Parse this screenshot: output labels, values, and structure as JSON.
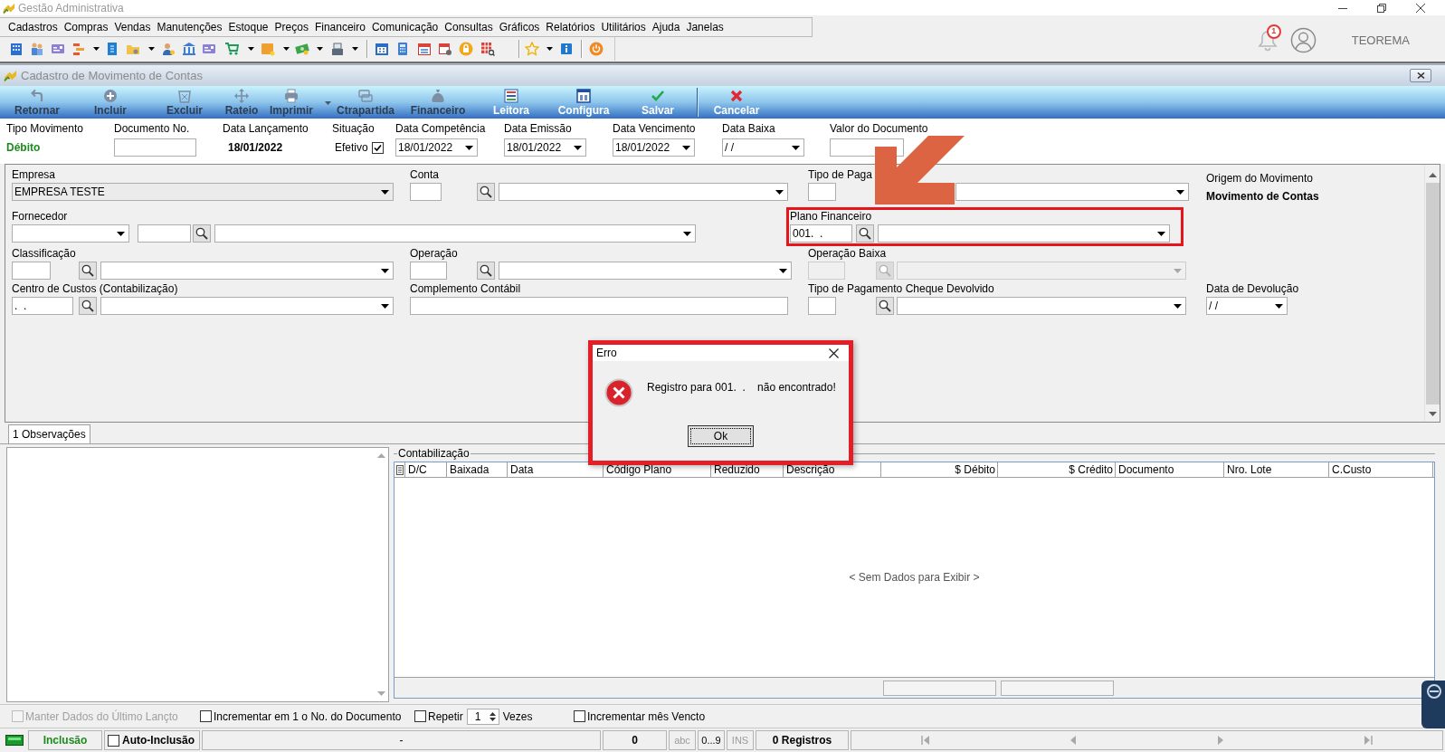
{
  "window": {
    "title": "Gestão Administrativa"
  },
  "menu": [
    "Cadastros",
    "Compras",
    "Vendas",
    "Manutenções",
    "Estoque",
    "Preços",
    "Financeiro",
    "Comunicação",
    "Consultas",
    "Gráficos",
    "Relatórios",
    "Utilitários",
    "Ajuda",
    "Janelas"
  ],
  "notifications": {
    "count": "1"
  },
  "user": {
    "name": "TEOREMA"
  },
  "document_window": {
    "title": "Cadastro de Movimento de Contas"
  },
  "toolbar": {
    "buttons": [
      {
        "label": "Retornar",
        "disabled": true,
        "menu": false
      },
      {
        "label": "Incluir",
        "disabled": true,
        "menu": false
      },
      {
        "label": "Excluir",
        "disabled": true,
        "menu": false
      },
      {
        "label": "Rateio",
        "disabled": true,
        "menu": false
      },
      {
        "label": "Imprimir",
        "disabled": true,
        "menu": true
      },
      {
        "label": "Ctrapartida",
        "disabled": true,
        "menu": false
      },
      {
        "label": "Financeiro",
        "disabled": true,
        "menu": false
      },
      {
        "label": "Leitora",
        "disabled": false,
        "menu": false
      },
      {
        "label": "Configura",
        "disabled": false,
        "menu": false
      },
      {
        "label": "Salvar",
        "disabled": false,
        "menu": false
      }
    ],
    "trailing": [
      {
        "label": "Cancelar",
        "disabled": false,
        "menu": false
      }
    ]
  },
  "header": [
    {
      "kind": "status",
      "label": "Tipo Movimento",
      "value": "Débito"
    },
    {
      "kind": "input",
      "label": "Documento No."
    },
    {
      "kind": "value",
      "label": "Data Lançamento",
      "value": "18/01/2022"
    },
    {
      "kind": "check",
      "label": "Situação",
      "text": "Efetivo",
      "checked": true
    },
    {
      "kind": "date",
      "label": "Data Competência",
      "value": "18/01/2022"
    },
    {
      "kind": "date",
      "label": "Data Emissão",
      "value": "18/01/2022"
    },
    {
      "kind": "date",
      "label": "Data Vencimento",
      "value": "18/01/2022"
    },
    {
      "kind": "date",
      "label": "Data Baixa",
      "value": "/ /"
    },
    {
      "kind": "input",
      "label": "Valor do Documento"
    }
  ],
  "form": {
    "fields": [
      {
        "kind": "combo",
        "label": "Empresa",
        "value": "EMPRESA TESTE",
        "disabled": false,
        "highlighted": false
      },
      {
        "kind": "lookup",
        "label": "Conta",
        "disabled": false,
        "highlighted": false
      },
      {
        "kind": "code_combo",
        "label": "Tipo de Paga",
        "disabled": false,
        "highlighted": false
      },
      {
        "kind": "info",
        "label": "Origem do Movimento",
        "value": "Movimento de Contas",
        "disabled": false,
        "highlighted": false
      },
      {
        "kind": "typed_lookup",
        "label": "Fornecedor",
        "disabled": false,
        "highlighted": false
      },
      {
        "kind": "lookup",
        "label": "Plano Financeiro",
        "code": "001.  .",
        "disabled": false,
        "highlighted": true
      },
      {
        "kind": "lookup",
        "label": "Classificação",
        "disabled": false,
        "highlighted": false
      },
      {
        "kind": "lookup",
        "label": "Operação",
        "disabled": false,
        "highlighted": false
      },
      {
        "kind": "lookup",
        "label": "Operação Baixa",
        "disabled": true,
        "highlighted": false
      },
      {
        "kind": "lookup",
        "label": "Centro de Custos (Contabilização)",
        "code": ".  .",
        "disabled": false,
        "highlighted": false
      },
      {
        "kind": "text",
        "label": "Complemento Contábil",
        "disabled": false,
        "highlighted": false
      },
      {
        "kind": "lookup",
        "label": "Tipo de Pagamento Cheque Devolvido",
        "disabled": false,
        "highlighted": false
      },
      {
        "kind": "date",
        "label": "Data de Devolução",
        "value": "/ /",
        "disabled": false,
        "highlighted": false
      }
    ]
  },
  "tabs": [
    {
      "label": "1 Observações",
      "selected": true
    }
  ],
  "accounting": {
    "title": "Contabilização",
    "columns": [
      {
        "label": "D/C",
        "kind": "text"
      },
      {
        "label": "Baixada",
        "kind": "text"
      },
      {
        "label": "Data",
        "kind": "text"
      },
      {
        "label": "Código Plano",
        "kind": "text"
      },
      {
        "label": "Reduzido",
        "kind": "text"
      },
      {
        "label": "Descrição",
        "kind": "text"
      },
      {
        "label": "$ Débito",
        "kind": "amount"
      },
      {
        "label": "$ Crédito",
        "kind": "amount"
      },
      {
        "label": "Documento",
        "kind": "text"
      },
      {
        "label": "Nro. Lote",
        "kind": "text"
      },
      {
        "label": "C.Custo",
        "kind": "text"
      }
    ],
    "empty_message": "< Sem Dados para Exibir >"
  },
  "options": [
    {
      "kind": "check",
      "label": "Manter Dados do Último Lançto",
      "checked": false,
      "disabled": true
    },
    {
      "kind": "check",
      "label": "Incrementar em 1 o No. do Documento",
      "checked": false,
      "disabled": false
    },
    {
      "kind": "repeat",
      "label": "Repetir",
      "checked": false,
      "disabled": false,
      "count": "1",
      "unit": "Vezes"
    },
    {
      "kind": "check",
      "label": "Incrementar mês Vencto",
      "checked": false,
      "disabled": false
    }
  ],
  "status_bar": {
    "mode": "Inclusão",
    "auto_inclusion": {
      "label": "Auto-Inclusão",
      "checked": false
    },
    "message": "-",
    "count": "0",
    "indicators": [
      {
        "label": "abc",
        "active": false
      },
      {
        "label": "0...9",
        "active": true
      },
      {
        "label": "INS",
        "active": false
      }
    ],
    "records": "0 Registros",
    "navigation": {
      "enabled": false
    }
  },
  "dialog": {
    "kind": "error",
    "title": "Erro",
    "message": "Registro para 001.  .    não encontrado!",
    "button": "Ok",
    "highlighted": true
  }
}
